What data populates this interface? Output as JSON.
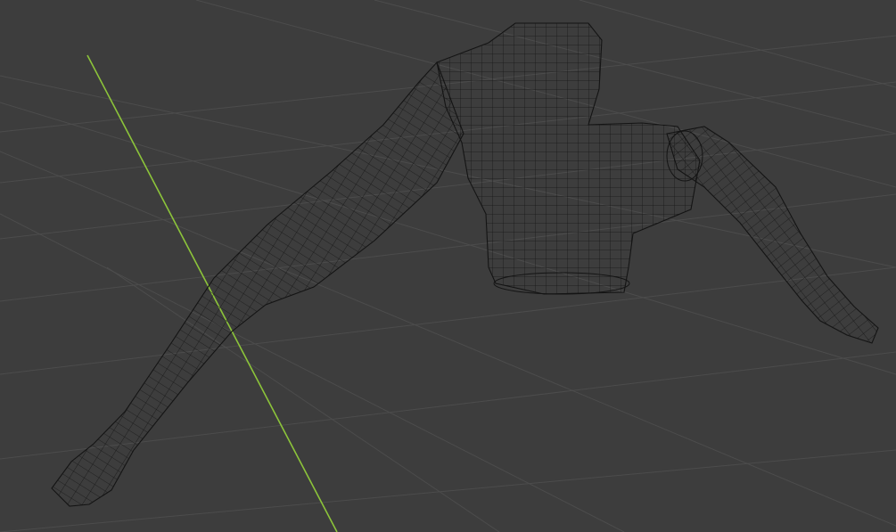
{
  "viewport": {
    "background_color": "#3d3d3d",
    "grid_line_color": "#4c4c4c",
    "y_axis_color": "#8cc43a",
    "wireframe_color": "#141414"
  },
  "object": {
    "display_mode": "wireframe",
    "parts": [
      "torso",
      "arm-left",
      "arm-right"
    ]
  }
}
